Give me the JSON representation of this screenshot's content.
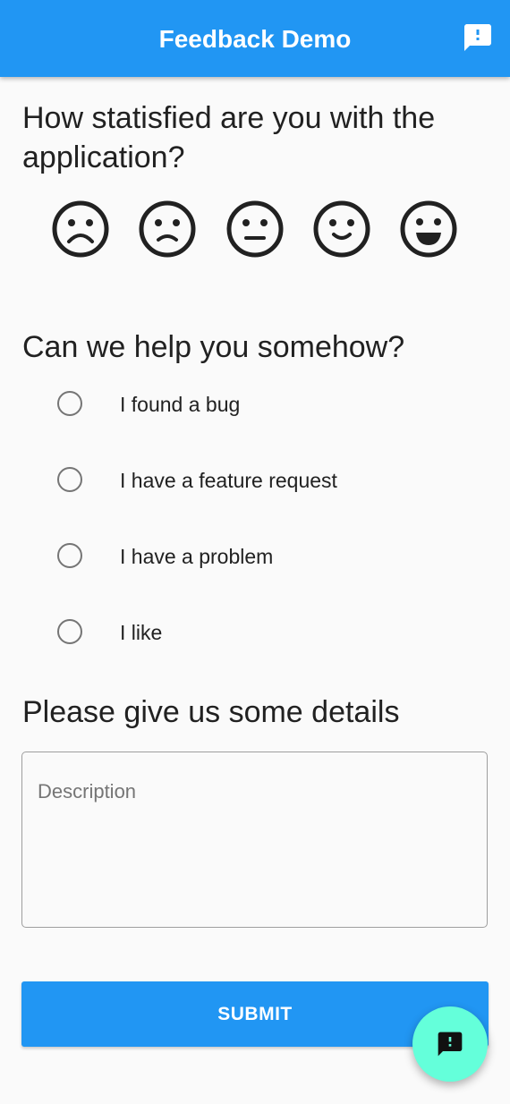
{
  "appbar": {
    "title": "Feedback Demo",
    "action_icon": "feedback-icon",
    "color": "#2196f3"
  },
  "rating": {
    "question": "How statisfied are you with the application?",
    "options": [
      {
        "icon": "very-dissatisfied-icon"
      },
      {
        "icon": "dissatisfied-icon"
      },
      {
        "icon": "neutral-icon"
      },
      {
        "icon": "satisfied-icon"
      },
      {
        "icon": "very-satisfied-icon"
      }
    ]
  },
  "help": {
    "question": "Can we help you somehow?",
    "options": [
      {
        "label": "I found a bug",
        "selected": false
      },
      {
        "label": "I have a feature request",
        "selected": false
      },
      {
        "label": "I have a problem",
        "selected": false
      },
      {
        "label": "I like",
        "selected": false
      }
    ]
  },
  "details": {
    "question": "Please give us some details",
    "placeholder": "Description",
    "value": ""
  },
  "submit": {
    "label": "SUBMIT",
    "color": "#2196f3"
  },
  "fab": {
    "icon": "feedback-icon",
    "color": "#64ffda"
  }
}
